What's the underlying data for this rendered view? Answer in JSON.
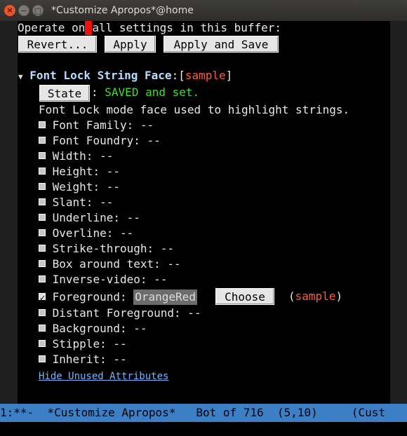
{
  "window": {
    "title": "*Customize Apropos*@home",
    "close_icon": "×",
    "min_icon": "−",
    "max_icon": "□"
  },
  "buffer": {
    "operate_prefix": "Operate on",
    "operate_suffix": "all settings in this buffer:",
    "buttons": {
      "revert": "Revert...",
      "apply": "Apply",
      "apply_save": "Apply and Save"
    },
    "face": {
      "triangle": "▼",
      "name": "Font Lock String Face",
      "colon_bracket": ":[",
      "sample": "sample",
      "close_bracket": "]",
      "state_button": "State",
      "state_sep": ":",
      "state_text": "SAVED and set.",
      "doc": "Font Lock mode face used to highlight strings."
    },
    "attributes": [
      {
        "label": "Font Family: --"
      },
      {
        "label": "Font Foundry: --"
      },
      {
        "label": "Width: --"
      },
      {
        "label": "Height: --"
      },
      {
        "label": "Weight: --"
      },
      {
        "label": "Slant: --"
      },
      {
        "label": "Underline: --"
      },
      {
        "label": "Overline: --"
      },
      {
        "label": "Strike-through: --"
      },
      {
        "label": "Box around text: --"
      },
      {
        "label": "Inverse-video: --"
      }
    ],
    "foreground": {
      "label": "Foreground:",
      "value": "OrangeRed",
      "choose": "Choose",
      "open_paren": "(",
      "sample": "sample",
      "close_paren": ")"
    },
    "attributes_after": [
      {
        "label": "Distant Foreground: --"
      },
      {
        "label": "Background: --"
      },
      {
        "label": "Stipple: --"
      },
      {
        "label": "Inherit: --"
      }
    ],
    "hide_link": "Hide Unused Attributes"
  },
  "modeline": {
    "text": "1:**-  *Customize Apropos*   Bot of 716  (5,10)     (Cust"
  },
  "colors": {
    "sample_red": "#ff5d38",
    "saved_green": "#44dd33",
    "face_name_blue": "#b7dcff",
    "modeline_blue": "#3d7fc4"
  }
}
